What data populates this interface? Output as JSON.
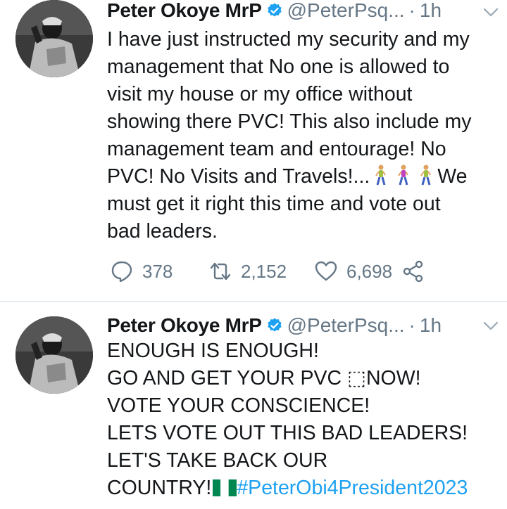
{
  "tweets": [
    {
      "author": "Peter Okoye MrP",
      "handle": "@PeterPsq...",
      "separator": "·",
      "time": "1h",
      "lines": [
        "I have just instructed my security and my",
        "management that No one is allowed to",
        "visit my house or my office without",
        "showing there PVC! This also include my",
        "management team and entourage! No"
      ],
      "line6_text": "PVC! No Visits and Travels!...",
      "line6_after": "We",
      "line7": "must get it right this time and vote out",
      "line8": "bad leaders.",
      "stats": {
        "replies": "378",
        "retweets": "2,152",
        "likes": "6,698"
      }
    },
    {
      "author": "Peter Okoye MrP",
      "handle": "@PeterPsq...",
      "separator": "·",
      "time": "1h",
      "lines": [
        "ENOUGH IS ENOUGH!",
        "GO AND GET YOUR PVC ⬚NOW!",
        "VOTE YOUR CONSCIENCE!",
        "LETS VOTE OUT THIS BAD LEADERS!",
        "LET'S TAKE BACK OUR"
      ],
      "last_line_text": "COUNTRY!",
      "hashtag": "#PeterObi4President2023"
    }
  ],
  "icons": {
    "verified": "verified-badge-icon",
    "chevron": "chevron-down-icon",
    "reply": "reply-icon",
    "retweet": "retweet-icon",
    "like": "heart-icon",
    "share": "share-icon",
    "walking": "person-walking-emoji",
    "flag": "nigeria-flag-emoji"
  },
  "colors": {
    "accent": "#1da1f2",
    "muted": "#657786",
    "text": "#14171a",
    "divider": "#e6ecf0"
  }
}
